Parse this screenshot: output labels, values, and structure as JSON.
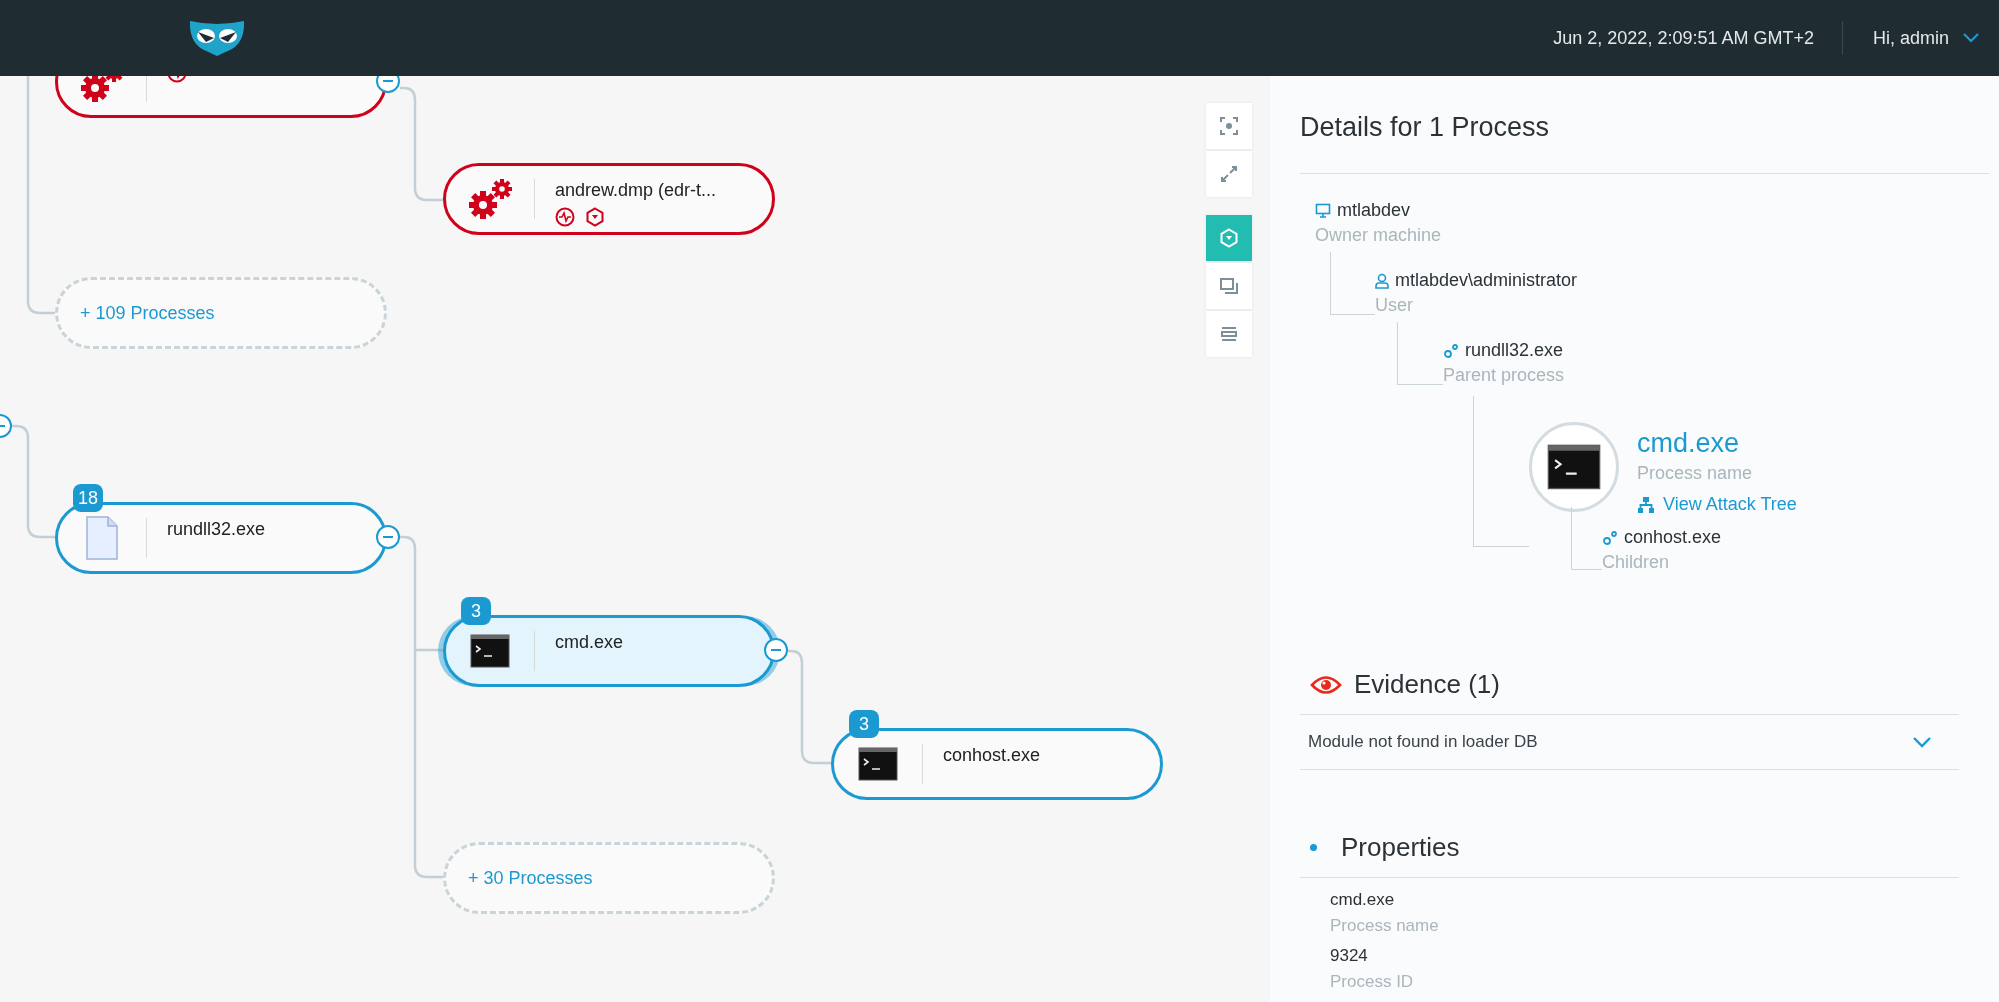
{
  "header": {
    "datetime": "Jun 2, 2022, 2:09:51 AM GMT+2",
    "user_menu": "Hi, admin"
  },
  "toolbar": {
    "view_controls": [
      {
        "kind": "focus",
        "selected": false
      },
      {
        "kind": "expand",
        "selected": false
      }
    ],
    "mode_controls": [
      {
        "kind": "hexagon",
        "selected": true
      },
      {
        "kind": "windows",
        "selected": false
      },
      {
        "kind": "list",
        "selected": false
      }
    ]
  },
  "graph": {
    "nodes": [
      {
        "kind": "process",
        "color": "#d0021b",
        "selected": false,
        "collapse_control": true
      },
      {
        "kind": "process",
        "label": "andrew.dmp (edr-t...",
        "color": "#d0021b",
        "selected": false,
        "collapse_control": false
      },
      {
        "kind": "more",
        "label": "+ 109 Processes"
      },
      {
        "kind": "process",
        "label": "rundll32.exe",
        "badge": "18",
        "color": "#1b9ad2",
        "selected": false,
        "collapse_control": true
      },
      {
        "kind": "process",
        "label": "cmd.exe",
        "badge": "3",
        "color": "#1b9ad2",
        "selected": true,
        "collapse_control": true
      },
      {
        "kind": "process",
        "label": "conhost.exe",
        "badge": "3",
        "color": "#1b9ad2",
        "selected": false,
        "collapse_control": false
      },
      {
        "kind": "more",
        "label": "+ 30 Processes"
      }
    ]
  },
  "details": {
    "title": "Details for 1 Process",
    "hierarchy": {
      "kind": "machine",
      "value": "mtlabdev",
      "label": "Owner machine",
      "children": [
        {
          "kind": "user",
          "value": "mtlabdev\\administrator",
          "label": "User",
          "children": [
            {
              "kind": "process",
              "value": "rundll32.exe",
              "label": "Parent process",
              "children": [
                {
                  "kind": "current",
                  "value": "cmd.exe",
                  "label": "Process name",
                  "link": "View Attack Tree",
                  "children": [
                    {
                      "kind": "process",
                      "value": "conhost.exe",
                      "label": "Children"
                    }
                  ]
                }
              ]
            }
          ]
        }
      ]
    },
    "evidence": {
      "title": "Evidence (1)",
      "items": [
        {
          "text": "Module not found in loader DB",
          "expanded": false
        }
      ]
    },
    "properties": {
      "title": "Properties",
      "items": [
        {
          "value": "cmd.exe",
          "label": "Process name"
        },
        {
          "value": "9324",
          "label": "Process ID"
        }
      ]
    }
  }
}
